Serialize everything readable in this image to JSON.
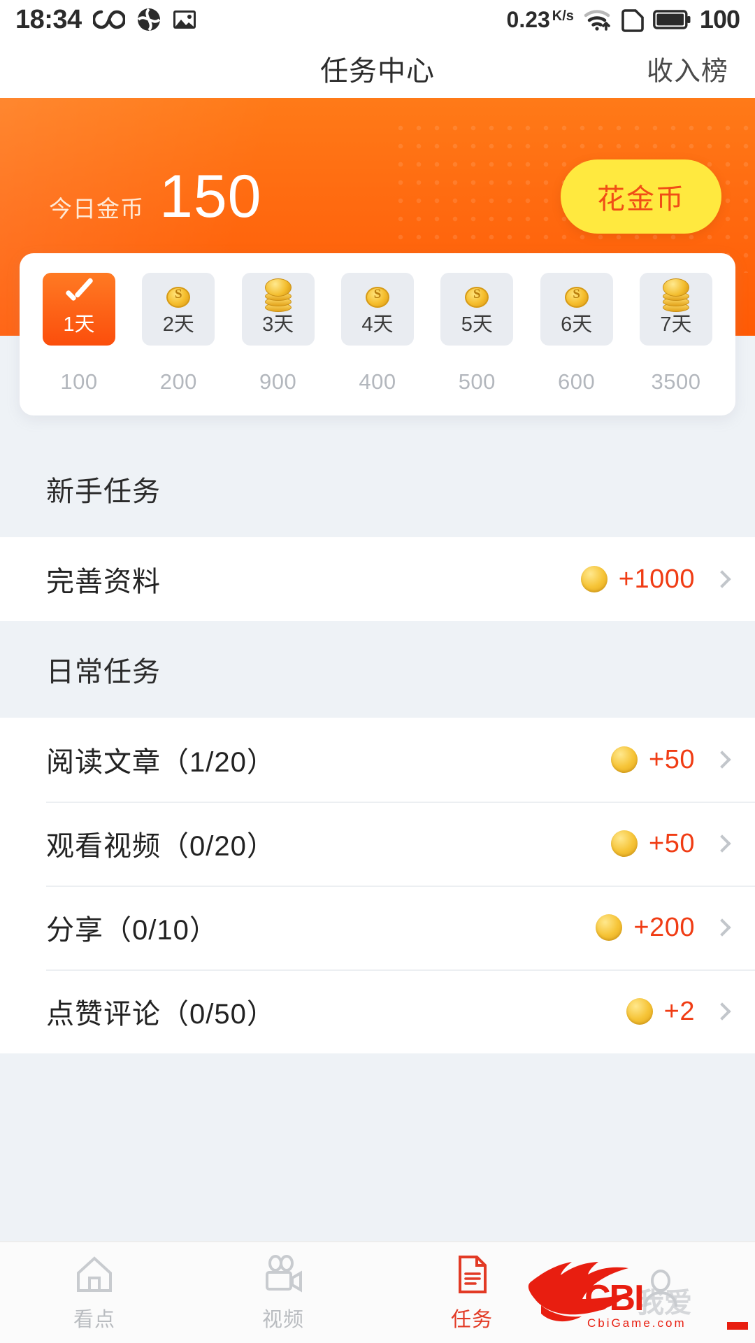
{
  "status_bar": {
    "time": "18:34",
    "icons_left": [
      "infinity-icon",
      "swirl-icon",
      "gallery-icon"
    ],
    "network_speed": "0.23",
    "network_speed_unit": "K/s",
    "icons_right": [
      "wifi-icon",
      "sim-card-icon",
      "battery-icon"
    ],
    "battery_level": "100"
  },
  "header": {
    "title": "任务中心",
    "right_link": "收入榜"
  },
  "banner": {
    "coin_label": "今日金币",
    "coin_value": "150",
    "spend_button": "花金币",
    "bg_color": "#ff6a10"
  },
  "checkin": {
    "days": [
      {
        "label": "1天",
        "amount": "100",
        "icon": "check-icon",
        "active": true
      },
      {
        "label": "2天",
        "amount": "200",
        "icon": "coin-icon",
        "active": false
      },
      {
        "label": "3天",
        "amount": "900",
        "icon": "coin-stack-icon",
        "active": false
      },
      {
        "label": "4天",
        "amount": "400",
        "icon": "coin-icon",
        "active": false
      },
      {
        "label": "5天",
        "amount": "500",
        "icon": "coin-icon",
        "active": false
      },
      {
        "label": "6天",
        "amount": "600",
        "icon": "coin-icon",
        "active": false
      },
      {
        "label": "7天",
        "amount": "3500",
        "icon": "coin-stack-icon",
        "active": false
      }
    ]
  },
  "sections": [
    {
      "title": "新手任务",
      "tasks": [
        {
          "name": "完善资料",
          "reward": "+1000"
        }
      ]
    },
    {
      "title": "日常任务",
      "tasks": [
        {
          "name": "阅读文章（1/20）",
          "reward": "+50"
        },
        {
          "name": "观看视频（0/20）",
          "reward": "+50"
        },
        {
          "name": "分享（0/10）",
          "reward": "+200"
        },
        {
          "name": "点赞评论（0/50）",
          "reward": "+2"
        }
      ]
    }
  ],
  "reward_color": "#f03c14",
  "bottom_nav": {
    "tabs": [
      {
        "label": "看点",
        "icon": "home-icon",
        "active": false
      },
      {
        "label": "视频",
        "icon": "video-icon",
        "active": false
      },
      {
        "label": "任务",
        "icon": "document-icon",
        "active": true
      },
      {
        "label": "",
        "icon": "profile-icon",
        "active": false
      }
    ]
  },
  "watermark": {
    "brand": "CBI",
    "site": "CbiGame.com",
    "cn": "我爱",
    "color": "#e81e10"
  }
}
